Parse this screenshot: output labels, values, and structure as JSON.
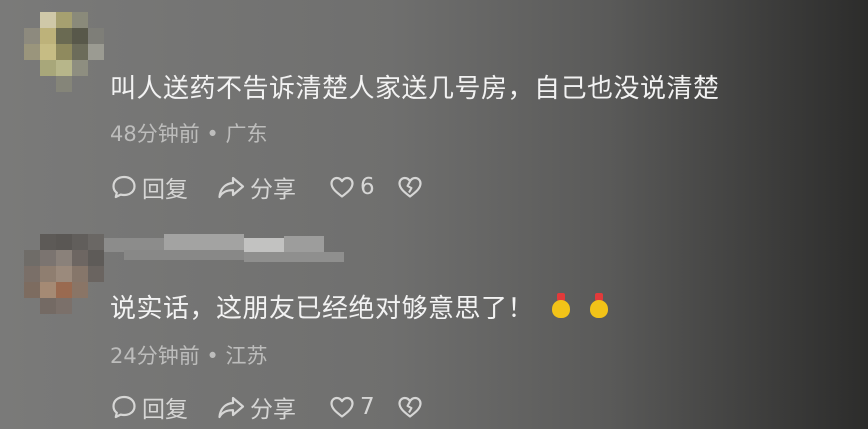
{
  "comments": [
    {
      "text": "叫人送药不告诉清楚人家送几号房，自己也没说清楚",
      "time": "48分钟前",
      "location": "广东",
      "reply_label": "回复",
      "share_label": "分享",
      "like_count": "6",
      "has_emoji": false
    },
    {
      "text": "说实话，这朋友已经绝对够意思了！",
      "time": "24分钟前",
      "location": "江苏",
      "reply_label": "回复",
      "share_label": "分享",
      "like_count": "7",
      "has_emoji": true,
      "emojis": [
        "gold-ingot-emoji",
        "gold-ingot-emoji"
      ]
    }
  ],
  "meta_separator": "•",
  "icons": [
    "comment-bubble-icon",
    "share-arrow-icon",
    "heart-icon",
    "broken-heart-icon"
  ],
  "colors": {
    "text": "#f2f2f2",
    "meta": "#bdbdbc",
    "action": "#d6d6d5"
  }
}
